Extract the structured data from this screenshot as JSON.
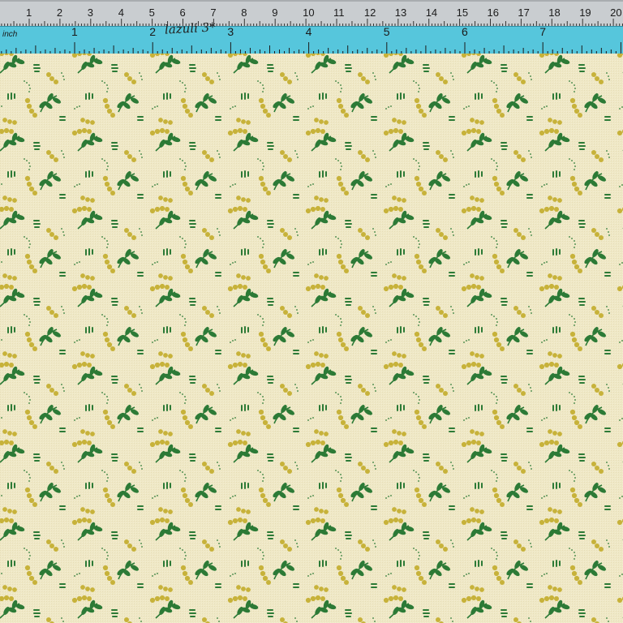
{
  "colors": {
    "fabric_background": "#efe8c6",
    "leaf_green": "#2c7a36",
    "dot_mustard": "#c7b23a",
    "cm_ruler": "#c9cdd0",
    "inch_ruler": "#56c6dc"
  },
  "cm_ruler": {
    "numbers": [
      "1",
      "2",
      "3",
      "4",
      "5",
      "6",
      "7",
      "8",
      "9",
      "10",
      "11",
      "12",
      "13",
      "14",
      "15",
      "16",
      "17",
      "18",
      "19",
      "20"
    ]
  },
  "inch_ruler": {
    "unit_label": "inch",
    "numbers": [
      "1",
      "2",
      "3",
      "4",
      "5",
      "6",
      "7"
    ],
    "handwritten_label": "lazuli 3*"
  },
  "fabric": {
    "motifs": [
      "green-leaf-sprig",
      "mustard-dot-chain",
      "small-dash-cluster"
    ]
  }
}
